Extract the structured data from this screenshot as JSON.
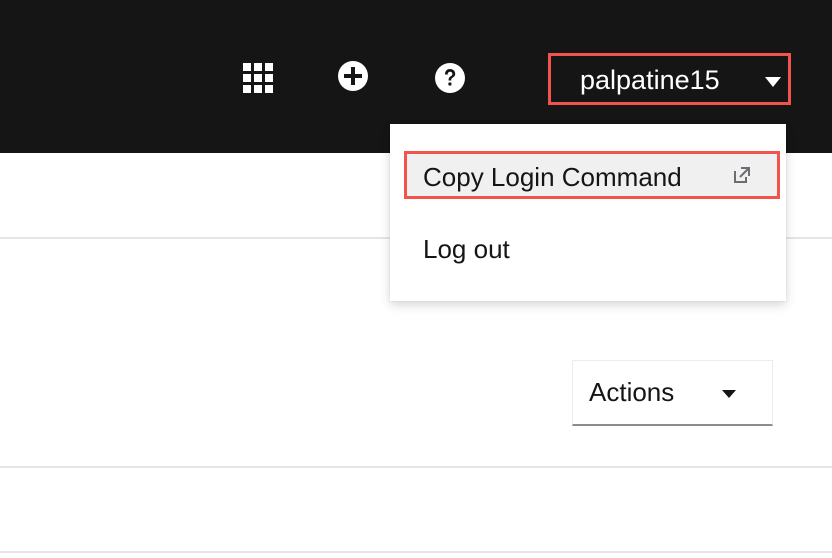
{
  "masthead": {
    "background": "#151515",
    "icons": {
      "app_launcher": "grid-icon",
      "import": "plus-circle-icon",
      "help": "question-circle-icon"
    },
    "user": {
      "name": "palpatine15",
      "dropdown_icon": "caret-down-icon"
    }
  },
  "user_menu": {
    "items": [
      {
        "label": "Copy Login Command",
        "icon": "external-link-icon"
      },
      {
        "label": "Log out"
      }
    ]
  },
  "actions": {
    "label": "Actions",
    "dropdown_icon": "caret-down-icon"
  },
  "highlight_color": "#f0544d"
}
